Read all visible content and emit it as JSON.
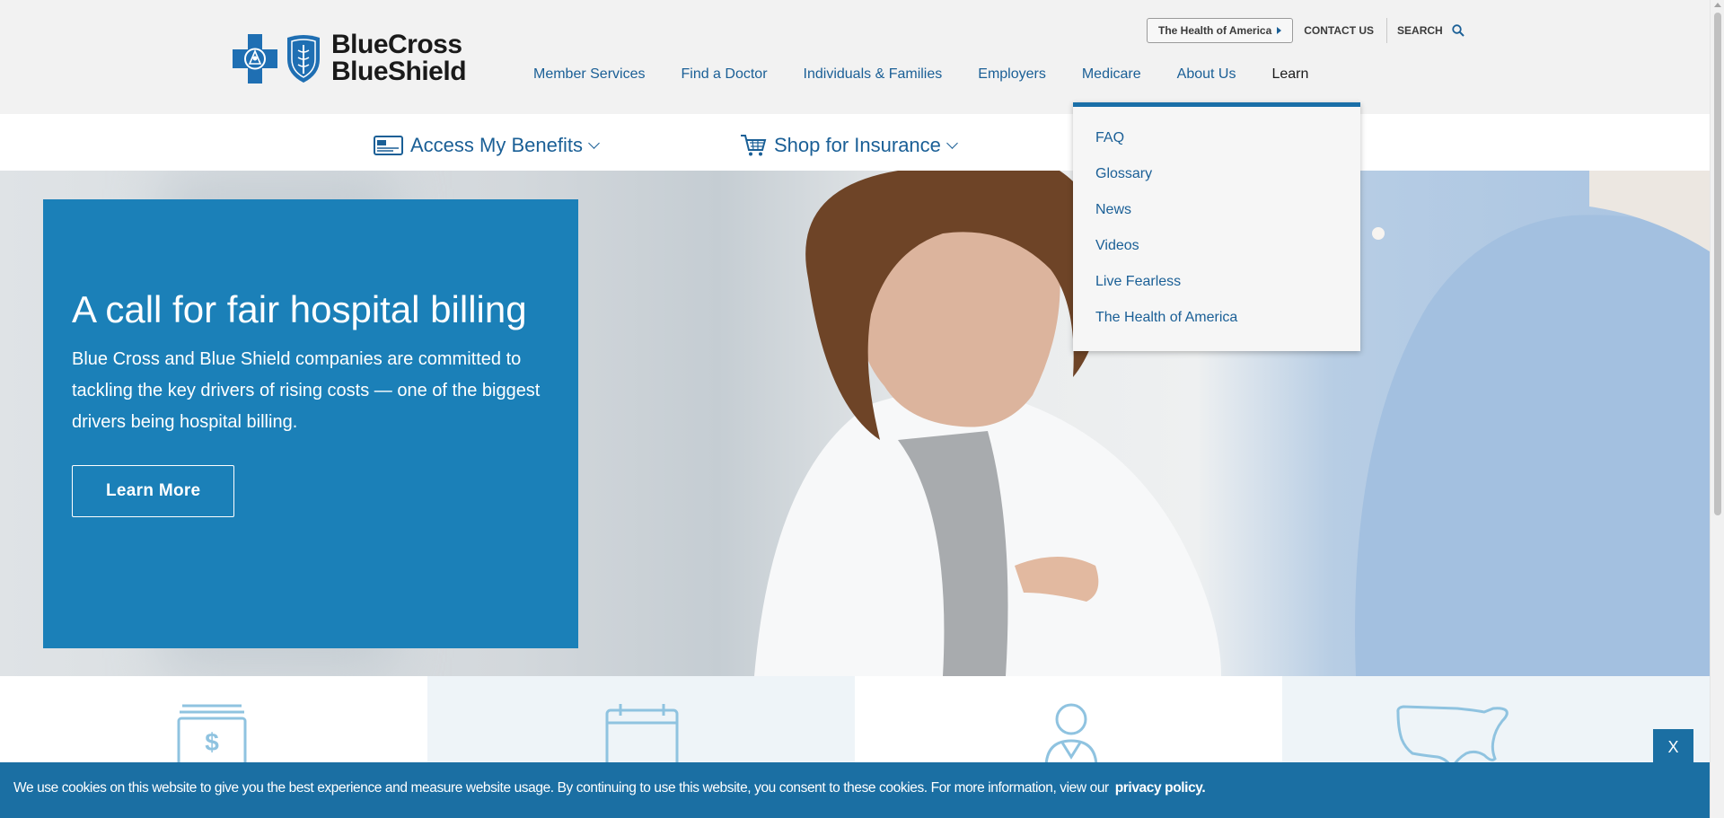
{
  "logo": {
    "line1": "BlueCross",
    "line2": "BlueShield"
  },
  "utility": {
    "health_of_america_button": "The Health of America",
    "contact_us": "CONTACT US",
    "search": "SEARCH"
  },
  "main_nav": [
    {
      "label": "Member Services"
    },
    {
      "label": "Find a Doctor"
    },
    {
      "label": "Individuals & Families"
    },
    {
      "label": "Employers"
    },
    {
      "label": "Medicare"
    },
    {
      "label": "About Us"
    },
    {
      "label": "Learn"
    }
  ],
  "sub_nav": {
    "access_benefits": "Access My Benefits",
    "shop_insurance": "Shop for Insurance"
  },
  "learn_dropdown": [
    {
      "label": "FAQ"
    },
    {
      "label": "Glossary"
    },
    {
      "label": "News"
    },
    {
      "label": "Videos"
    },
    {
      "label": "Live Fearless"
    },
    {
      "label": "The Health of America"
    }
  ],
  "hero": {
    "title": "A call for fair hospital billing",
    "body": "Blue Cross and Blue Shield companies are committed to tackling the key drivers of rising costs — one of the biggest drivers being hospital billing.",
    "button": "Learn More"
  },
  "features": [
    {
      "icon": "dollar-card-icon"
    },
    {
      "icon": "calendar-icon"
    },
    {
      "icon": "person-icon"
    },
    {
      "icon": "usa-map-icon"
    }
  ],
  "cookie": {
    "text": "We use cookies on this website to give you the best experience and measure website usage. By continuing to use this website, you consent to these cookies. For more information, view our",
    "link": "privacy policy.",
    "close": "X"
  },
  "colors": {
    "brand_blue": "#1a5f96",
    "promo_blue": "#1b80b8",
    "cookie_blue": "#1b6fa3",
    "header_gray": "#f2f2f2"
  }
}
